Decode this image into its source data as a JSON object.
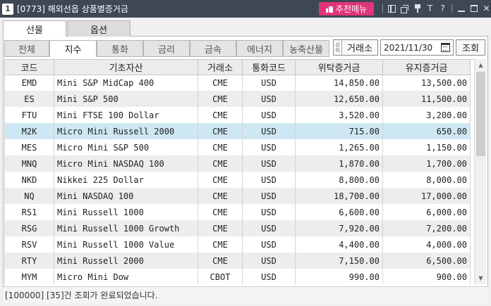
{
  "window": {
    "number": "1",
    "title": "[0773] 해외선옵 상품별증거금",
    "recommend_label": "추천메뉴",
    "text_icon": "T",
    "help_icon": "?"
  },
  "outer_tabs": [
    {
      "label": "선물",
      "active": true
    },
    {
      "label": "옵션",
      "active": false
    }
  ],
  "category_tabs": [
    {
      "label": "전체"
    },
    {
      "label": "지수"
    },
    {
      "label": "통화"
    },
    {
      "label": "금리"
    },
    {
      "label": "금속"
    },
    {
      "label": "에너지"
    },
    {
      "label": "농축산물"
    }
  ],
  "exchange": {
    "label": "거래소",
    "arrow_up": "상",
    "arrow_down": "하"
  },
  "date": {
    "value": "2021/11/30"
  },
  "query_button": "조회",
  "table": {
    "headers": [
      "코드",
      "기초자산",
      "거래소",
      "통화코드",
      "위탁증거금",
      "유지증거금"
    ],
    "rows": [
      {
        "code": "EMD",
        "asset": "Mini S&P MidCap 400",
        "exchange": "CME",
        "currency": "USD",
        "initial": "14,850.00",
        "maint": "13,500.00"
      },
      {
        "code": "ES",
        "asset": "Mini S&P 500",
        "exchange": "CME",
        "currency": "USD",
        "initial": "12,650.00",
        "maint": "11,500.00"
      },
      {
        "code": "FTU",
        "asset": "Mini FTSE 100 Dollar",
        "exchange": "CME",
        "currency": "USD",
        "initial": "3,520.00",
        "maint": "3,200.00"
      },
      {
        "code": "M2K",
        "asset": "Micro Mini Russell 2000",
        "exchange": "CME",
        "currency": "USD",
        "initial": "715.00",
        "maint": "650.00"
      },
      {
        "code": "MES",
        "asset": "Micro Mini S&P 500",
        "exchange": "CME",
        "currency": "USD",
        "initial": "1,265.00",
        "maint": "1,150.00"
      },
      {
        "code": "MNQ",
        "asset": "Micro Mini NASDAQ 100",
        "exchange": "CME",
        "currency": "USD",
        "initial": "1,870.00",
        "maint": "1,700.00"
      },
      {
        "code": "NKD",
        "asset": "Nikkei 225 Dollar",
        "exchange": "CME",
        "currency": "USD",
        "initial": "8,800.00",
        "maint": "8,000.00"
      },
      {
        "code": "NQ",
        "asset": "Mini NASDAQ 100",
        "exchange": "CME",
        "currency": "USD",
        "initial": "18,700.00",
        "maint": "17,000.00"
      },
      {
        "code": "RS1",
        "asset": "Mini Russell 1000",
        "exchange": "CME",
        "currency": "USD",
        "initial": "6,600.00",
        "maint": "6,000.00"
      },
      {
        "code": "RSG",
        "asset": "Mini Russell 1000 Growth",
        "exchange": "CME",
        "currency": "USD",
        "initial": "7,920.00",
        "maint": "7,200.00"
      },
      {
        "code": "RSV",
        "asset": "Mini Russell 1000 Value",
        "exchange": "CME",
        "currency": "USD",
        "initial": "4,400.00",
        "maint": "4,000.00"
      },
      {
        "code": "RTY",
        "asset": "Mini Russell 2000",
        "exchange": "CME",
        "currency": "USD",
        "initial": "7,150.00",
        "maint": "6,500.00"
      },
      {
        "code": "MYM",
        "asset": "Micro Mini Dow",
        "exchange": "CBOT",
        "currency": "USD",
        "initial": "990.00",
        "maint": "900.00"
      }
    ]
  },
  "status": "[100000] [35]건 조회가 완료되었습니다.",
  "colors": {
    "titlebar": "#3f4754",
    "recommend": "#e0357a",
    "selected_row": "#cde8f2",
    "alt_row": "#ededed"
  }
}
